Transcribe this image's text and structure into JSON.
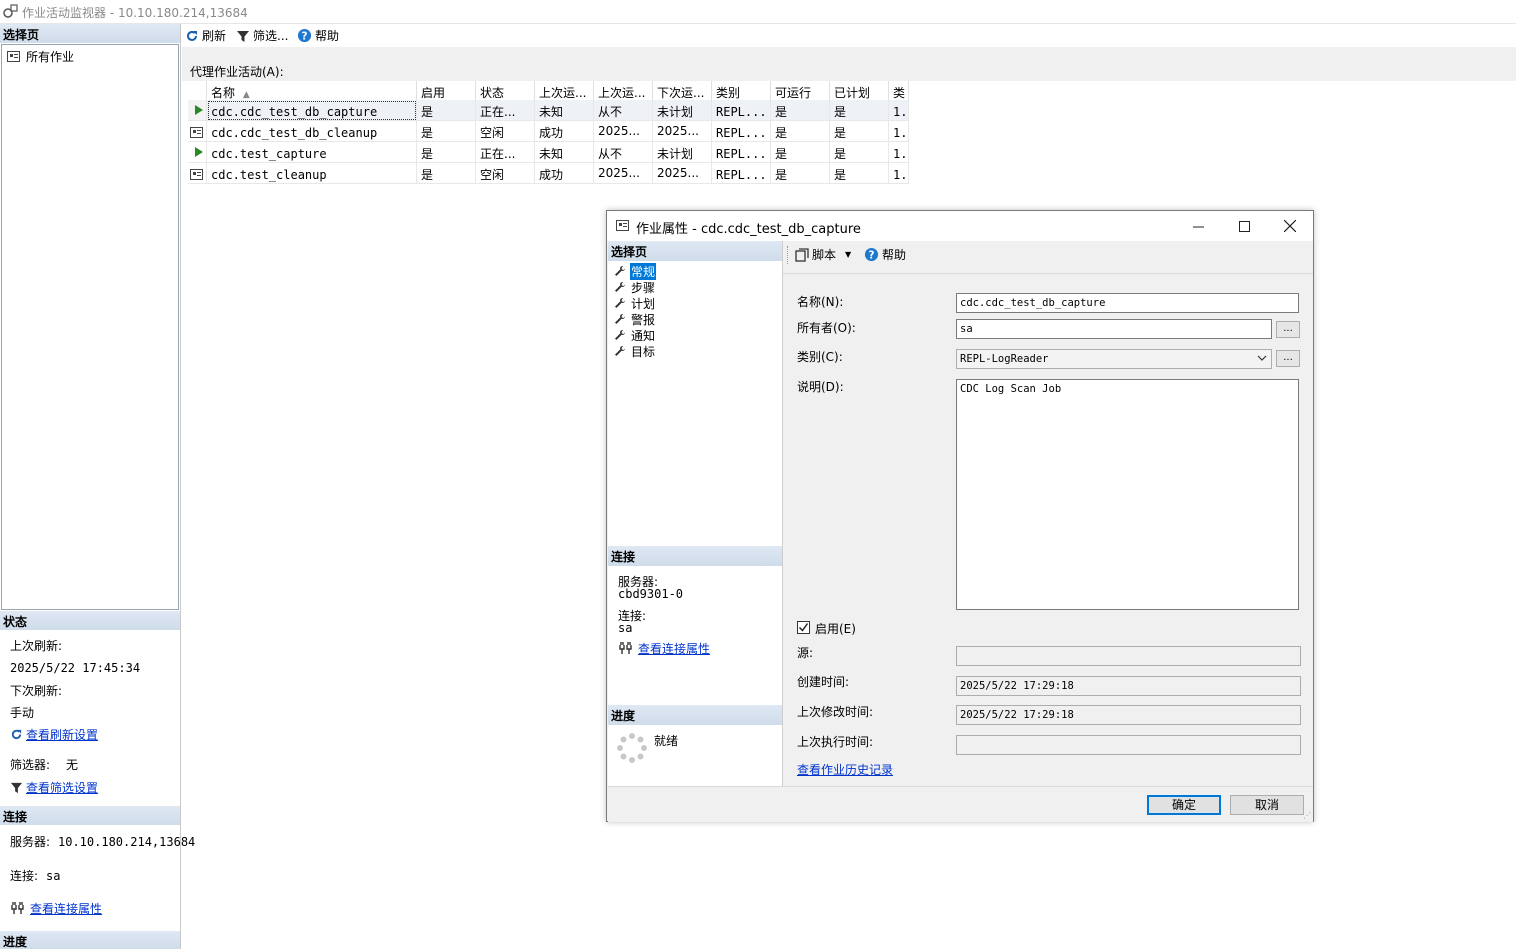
{
  "main_title": "作业活动监视器 - 10.10.180.214,13684",
  "left": {
    "select_page_header": "选择页",
    "all_jobs": "所有作业",
    "status_header": "状态",
    "last_refresh_label": "上次刷新:",
    "last_refresh_value": "2025/5/22 17:45:34",
    "next_refresh_label": "下次刷新:",
    "next_refresh_value": "手动",
    "view_refresh_settings": "查看刷新设置",
    "filter_label": "筛选器:",
    "filter_value": "无",
    "view_filter_settings": "查看筛选设置",
    "connection_header": "连接",
    "server_label": "服务器:",
    "server_value": "10.10.180.214,13684",
    "connection_label": "连接:",
    "connection_value": "sa",
    "view_connection_props": "查看连接属性",
    "progress_header": "进度"
  },
  "toolbar": {
    "refresh": "刷新",
    "filter": "筛选...",
    "help": "帮助"
  },
  "grid_label": "代理作业活动(A):",
  "grid": {
    "columns": [
      "名称",
      "启用",
      "状态",
      "上次运...",
      "上次运...",
      "下次运...",
      "类别",
      "可运行",
      "已计划",
      "类"
    ],
    "rows": [
      {
        "name": "cdc.cdc_test_db_capture",
        "enabled": "是",
        "status": "正在...",
        "last_outcome": "未知",
        "last_run": "从不",
        "next_run": "未计划",
        "category": "REPL...",
        "runnable": "是",
        "scheduled": "是",
        "type": "1.",
        "running": true
      },
      {
        "name": "cdc.cdc_test_db_cleanup",
        "enabled": "是",
        "status": "空闲",
        "last_outcome": "成功",
        "last_run": "2025...",
        "next_run": "2025...",
        "category": "REPL...",
        "runnable": "是",
        "scheduled": "是",
        "type": "1.",
        "running": false
      },
      {
        "name": "cdc.test_capture",
        "enabled": "是",
        "status": "正在...",
        "last_outcome": "未知",
        "last_run": "从不",
        "next_run": "未计划",
        "category": "REPL...",
        "runnable": "是",
        "scheduled": "是",
        "type": "1.",
        "running": true
      },
      {
        "name": "cdc.test_cleanup",
        "enabled": "是",
        "status": "空闲",
        "last_outcome": "成功",
        "last_run": "2025...",
        "next_run": "2025...",
        "category": "REPL...",
        "runnable": "是",
        "scheduled": "是",
        "type": "1.",
        "running": false
      }
    ]
  },
  "dialog": {
    "title": "作业属性 - cdc.cdc_test_db_capture",
    "select_page_header": "选择页",
    "pages": [
      "常规",
      "步骤",
      "计划",
      "警报",
      "通知",
      "目标"
    ],
    "connection_header": "连接",
    "server_label": "服务器:",
    "server_value": "cbd9301-0",
    "connection_label": "连接:",
    "connection_value": "sa",
    "view_connection_props": "查看连接属性",
    "progress_header": "进度",
    "progress_status": "就绪",
    "toolbar_script": "脚本",
    "toolbar_help": "帮助",
    "name_label": "名称(N):",
    "name_value": "cdc.cdc_test_db_capture",
    "owner_label": "所有者(O):",
    "owner_value": "sa",
    "category_label": "类别(C):",
    "category_value": "REPL-LogReader",
    "description_label": "说明(D):",
    "description_value": "CDC Log Scan Job",
    "enabled_label": "启用(E)",
    "enabled_checked": true,
    "source_label": "源:",
    "source_value": "",
    "created_label": "创建时间:",
    "created_value": "2025/5/22 17:29:18",
    "modified_label": "上次修改时间:",
    "modified_value": "2025/5/22 17:29:18",
    "executed_label": "上次执行时间:",
    "executed_value": "",
    "view_history": "查看作业历史记录",
    "ok_button": "确定",
    "cancel_button": "取消",
    "ellipsis": "..."
  },
  "colors": {
    "section_header": "#cfdcea",
    "selection": "#0078d7",
    "link": "#0033cc",
    "running_green": "#2a8a2a"
  }
}
